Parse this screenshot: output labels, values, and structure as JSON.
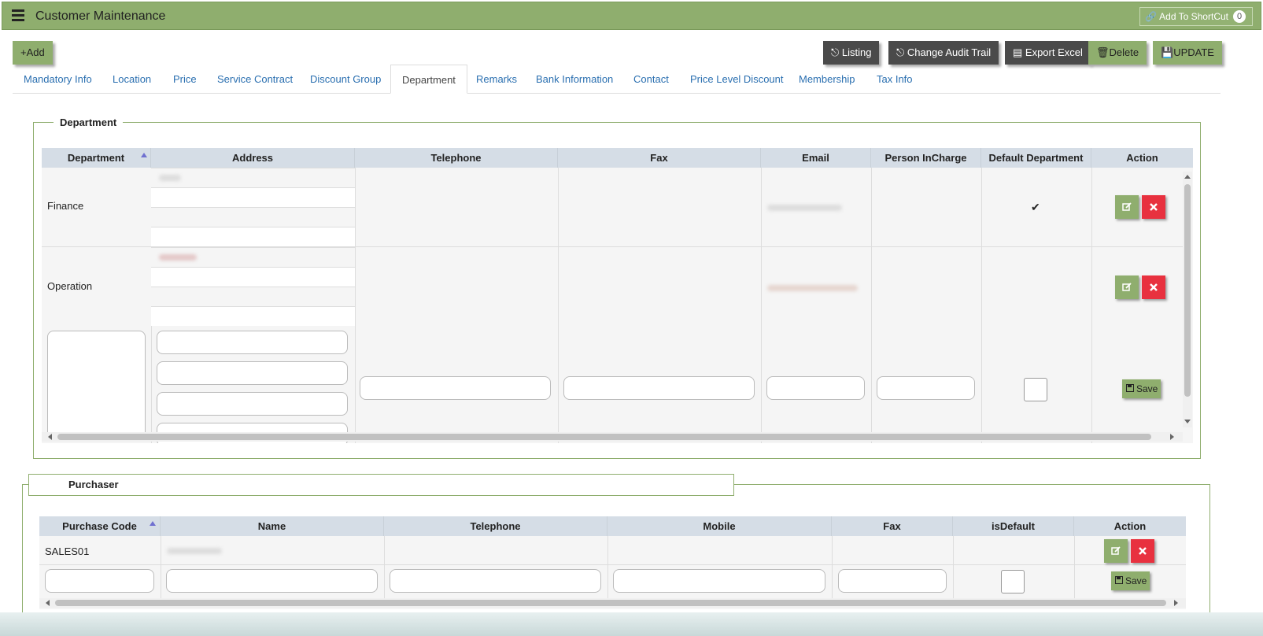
{
  "header": {
    "title": "Customer Maintenance",
    "shortcut_label": "Add To ShortCut",
    "shortcut_count": "0"
  },
  "toolbar": {
    "add_label": "+Add",
    "listing_label": "Listing",
    "audit_label": "Change Audit Trail",
    "export_label": "Export Excel",
    "delete_label": "Delete",
    "update_label": "UPDATE"
  },
  "tabs": [
    "Mandatory Info",
    "Location",
    "Price",
    "Service Contract",
    "Discount Group",
    "Department",
    "Remarks",
    "Bank Information",
    "Contact",
    "Price Level Discount",
    "Membership",
    "Tax Info"
  ],
  "active_tab": "Department",
  "department": {
    "legend": "Department",
    "columns": [
      "Department",
      "Address",
      "Telephone",
      "Fax",
      "Email",
      "Person InCharge",
      "Default Department",
      "Action"
    ],
    "rows": [
      {
        "department": "Finance",
        "default": "✔"
      },
      {
        "department": "Operation",
        "default": ""
      }
    ],
    "save_label": "Save"
  },
  "purchaser": {
    "legend": "Purchaser",
    "columns": [
      "Purchase Code",
      "Name",
      "Telephone",
      "Mobile",
      "Fax",
      "isDefault",
      "Action"
    ],
    "rows": [
      {
        "code": "SALES01"
      }
    ],
    "save_label": "Save"
  },
  "colors": {
    "accent": "#8fae6e",
    "dark_button": "#4a4a4a",
    "danger": "#e8313f",
    "link": "#2a6fb0"
  }
}
